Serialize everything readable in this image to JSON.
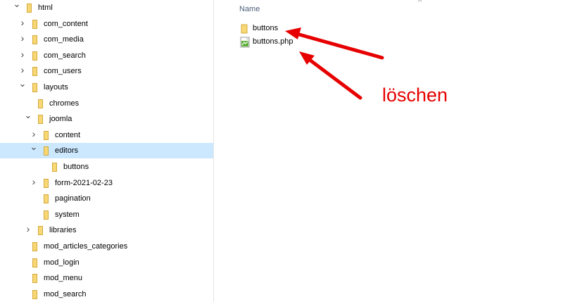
{
  "tree": [
    {
      "label": "html",
      "chev": "down",
      "lv": 0
    },
    {
      "label": "com_content",
      "chev": "right",
      "lv": 1
    },
    {
      "label": "com_media",
      "chev": "right",
      "lv": 1
    },
    {
      "label": "com_search",
      "chev": "right",
      "lv": 1
    },
    {
      "label": "com_users",
      "chev": "right",
      "lv": 1
    },
    {
      "label": "layouts",
      "chev": "down",
      "lv": 1
    },
    {
      "label": "chromes",
      "chev": "none",
      "lv": 2
    },
    {
      "label": "joomla",
      "chev": "down",
      "lv": 2
    },
    {
      "label": "content",
      "chev": "right",
      "lv": 3
    },
    {
      "label": "editors",
      "chev": "down",
      "lv": 3,
      "selected": true
    },
    {
      "label": "buttons",
      "chev": "none",
      "lv": 4
    },
    {
      "label": "form-2021-02-23",
      "chev": "right",
      "lv": 3
    },
    {
      "label": "pagination",
      "chev": "none",
      "lv": 3
    },
    {
      "label": "system",
      "chev": "none",
      "lv": 3
    },
    {
      "label": "libraries",
      "chev": "right",
      "lv": 2
    },
    {
      "label": "mod_articles_categories",
      "chev": "none",
      "lv": 1
    },
    {
      "label": "mod_login",
      "chev": "none",
      "lv": 1
    },
    {
      "label": "mod_menu",
      "chev": "none",
      "lv": 1
    },
    {
      "label": "mod_search",
      "chev": "none",
      "lv": 1
    }
  ],
  "list": {
    "header_name": "Name",
    "files": [
      {
        "label": "buttons",
        "type": "folder"
      },
      {
        "label": "buttons.php",
        "type": "php"
      }
    ]
  },
  "annotation": {
    "text": "löschen",
    "color": "#e60000"
  },
  "colors": {
    "selected": "#cce8ff",
    "folder": "#f8d775",
    "header": "#4c607a"
  },
  "icons": {
    "folder": "folder-icon",
    "php": "php-file-icon",
    "expand": "chevron-right-icon",
    "collapse": "chevron-down-icon",
    "sort": "sort-up-icon"
  }
}
